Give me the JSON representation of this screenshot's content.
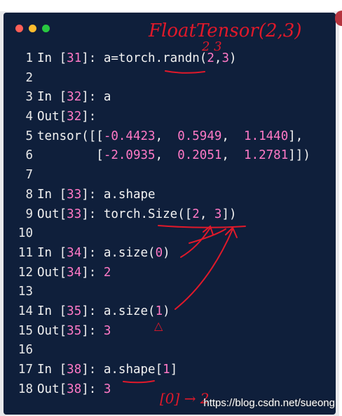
{
  "window": {
    "traffic_colors": [
      "#ff5f57",
      "#febc2e",
      "#28c840"
    ]
  },
  "code_lines": [
    [
      {
        "t": "In ["
      },
      {
        "t": "31",
        "c": "num"
      },
      {
        "t": "]: a=torch.randn("
      },
      {
        "t": "2",
        "c": "num"
      },
      {
        "t": ","
      },
      {
        "t": "3",
        "c": "num"
      },
      {
        "t": ")"
      }
    ],
    [],
    [
      {
        "t": "In ["
      },
      {
        "t": "32",
        "c": "num"
      },
      {
        "t": "]: a"
      }
    ],
    [
      {
        "t": "Out["
      },
      {
        "t": "32",
        "c": "num"
      },
      {
        "t": "]:"
      }
    ],
    [
      {
        "t": "tensor([["
      },
      {
        "t": "-0.4423",
        "c": "num"
      },
      {
        "t": ",  "
      },
      {
        "t": "0.5949",
        "c": "num"
      },
      {
        "t": ",  "
      },
      {
        "t": "1.1440",
        "c": "num"
      },
      {
        "t": "],"
      }
    ],
    [
      {
        "t": "        ["
      },
      {
        "t": "-2.0935",
        "c": "num"
      },
      {
        "t": ",  "
      },
      {
        "t": "0.2051",
        "c": "num"
      },
      {
        "t": ",  "
      },
      {
        "t": "1.2781",
        "c": "num"
      },
      {
        "t": "]])"
      }
    ],
    [],
    [
      {
        "t": "In ["
      },
      {
        "t": "33",
        "c": "num"
      },
      {
        "t": "]: a.shape"
      }
    ],
    [
      {
        "t": "Out["
      },
      {
        "t": "33",
        "c": "num"
      },
      {
        "t": "]: torch.Size(["
      },
      {
        "t": "2",
        "c": "num"
      },
      {
        "t": ", "
      },
      {
        "t": "3",
        "c": "num"
      },
      {
        "t": "])"
      }
    ],
    [],
    [
      {
        "t": "In ["
      },
      {
        "t": "34",
        "c": "num"
      },
      {
        "t": "]: a.size("
      },
      {
        "t": "0",
        "c": "num"
      },
      {
        "t": ")"
      }
    ],
    [
      {
        "t": "Out["
      },
      {
        "t": "34",
        "c": "num"
      },
      {
        "t": "]: "
      },
      {
        "t": "2",
        "c": "num"
      }
    ],
    [],
    [
      {
        "t": "In ["
      },
      {
        "t": "35",
        "c": "num"
      },
      {
        "t": "]: a.size("
      },
      {
        "t": "1",
        "c": "num"
      },
      {
        "t": ")"
      }
    ],
    [
      {
        "t": "Out["
      },
      {
        "t": "35",
        "c": "num"
      },
      {
        "t": "]: "
      },
      {
        "t": "3",
        "c": "num"
      }
    ],
    [],
    [
      {
        "t": "In ["
      },
      {
        "t": "38",
        "c": "num"
      },
      {
        "t": "]: a.shape["
      },
      {
        "t": "1",
        "c": "num"
      },
      {
        "t": "]"
      }
    ],
    [
      {
        "t": "Out["
      },
      {
        "t": "38",
        "c": "num"
      },
      {
        "t": "]: "
      },
      {
        "t": "3",
        "c": "num"
      }
    ]
  ],
  "annotations": {
    "title_note": "FloatTensor(2,3)",
    "sub_note": "2 3",
    "index_note": "[0] → 2",
    "marker_note": "△",
    "ink_color": "#e0192a"
  },
  "watermark": "https://blog.csdn.net/sueong"
}
